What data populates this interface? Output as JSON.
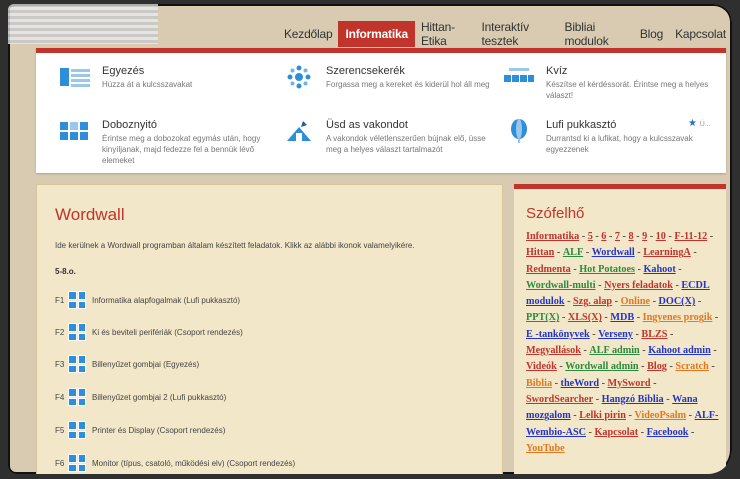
{
  "nav": {
    "items": [
      "Kezdőlap",
      "Informatika",
      "Hittan-Etika",
      "Interaktív tesztek",
      "Bibliai modulok",
      "Blog",
      "Kapcsolat"
    ],
    "active_index": 1
  },
  "dropdown": {
    "items": [
      {
        "title": "Egyezés",
        "desc": "Húzza át a kulcsszavakat",
        "icon": "match-icon"
      },
      {
        "title": "Szerencsekerék",
        "desc": "Forgassa meg a kereket és kiderül hol áll meg",
        "icon": "wheel-icon"
      },
      {
        "title": "Kvíz",
        "desc": "Készítse el kérdéssorát. Érintse meg a helyes választ!",
        "icon": "quiz-icon"
      },
      {
        "title": "Doboznyitó",
        "desc": "Érintse meg a dobozokat egymás után, hogy kinyíljanak, majd fedezze fel a bennük lévő elemeket",
        "icon": "boxes-icon"
      },
      {
        "title": "Üsd as vakondot",
        "desc": "A vakondok véletlenszerűen bújnak elő, üsse meg a helyes választ tartalmazót",
        "icon": "mole-icon"
      },
      {
        "title": "Lufi pukkasztó",
        "desc": "Durrantsd ki a lufikat, hogy a kulcsszavak egyezzenek",
        "icon": "balloon-icon"
      }
    ],
    "star_label": "Ú..."
  },
  "main": {
    "title": "Wordwall",
    "intro": "Ide kerülnek a Wordwall programban általam készített feladatok. Klikk az alábbi ikonok valamelyikére.",
    "grade": "5-8.o.",
    "rows": [
      {
        "code": "F1",
        "label": "Informatika alapfogalmak (Lufi pukkasztó)"
      },
      {
        "code": "F2",
        "label": "Ki és beviteli perifériák (Csoport rendezés)"
      },
      {
        "code": "F3",
        "label": "Billenyűzet gombjai (Egyezés)"
      },
      {
        "code": "F4",
        "label": "Billenyűzet gombjai 2 (Lufi pukkasztó)"
      },
      {
        "code": "F5",
        "label": "Printer és Display (Csoport rendezés)"
      },
      {
        "code": "F6",
        "label": "Monitor (típus, csatoló, működési elv) (Csoport rendezés)"
      }
    ]
  },
  "sidebar": {
    "title": "Szófelhő",
    "tags": [
      {
        "t": "Informatika",
        "c": "#c0342b"
      },
      {
        "t": "5",
        "c": "#c0342b"
      },
      {
        "t": "6",
        "c": "#c0342b"
      },
      {
        "t": "7",
        "c": "#c0342b"
      },
      {
        "t": "8",
        "c": "#c0342b"
      },
      {
        "t": "9",
        "c": "#c0342b"
      },
      {
        "t": "10",
        "c": "#c0342b"
      },
      {
        "t": "F-11-12",
        "c": "#c0342b"
      },
      {
        "t": "Hittan",
        "c": "#c0342b"
      },
      {
        "t": "ALF",
        "c": "#2b8a3e"
      },
      {
        "t": "Wordwall",
        "c": "#2334c9"
      },
      {
        "t": "LearningA",
        "c": "#c0342b"
      },
      {
        "t": "Redmenta",
        "c": "#c0342b"
      },
      {
        "t": "Hot Potatoes",
        "c": "#2b8a3e"
      },
      {
        "t": "Kahoot",
        "c": "#2334c9"
      },
      {
        "t": "Wordwall-multi",
        "c": "#2b8a3e"
      },
      {
        "t": "Nyers feladatok",
        "c": "#c0342b"
      },
      {
        "t": "ECDL modulok",
        "c": "#2334c9"
      },
      {
        "t": "Szg. alap",
        "c": "#c0342b"
      },
      {
        "t": "Online",
        "c": "#e0781e"
      },
      {
        "t": "DOC(X)",
        "c": "#2334c9"
      },
      {
        "t": "PPT(X)",
        "c": "#2b8a3e"
      },
      {
        "t": "XLS(X)",
        "c": "#c0342b"
      },
      {
        "t": "MDB",
        "c": "#2334c9"
      },
      {
        "t": "Ingyenes progik",
        "c": "#e0781e"
      },
      {
        "t": "E -tankönyvek",
        "c": "#2334c9"
      },
      {
        "t": "Verseny",
        "c": "#2334c9"
      },
      {
        "t": "BLZS",
        "c": "#c0342b"
      },
      {
        "t": "Megyallások",
        "c": "#c0342b"
      },
      {
        "t": "ALF admin",
        "c": "#2b8a3e"
      },
      {
        "t": "Kahoot admin",
        "c": "#2334c9"
      },
      {
        "t": "Videók",
        "c": "#c0342b"
      },
      {
        "t": "Wordwall admin",
        "c": "#2b8a3e"
      },
      {
        "t": "Blog",
        "c": "#c0342b"
      },
      {
        "t": "Scratch",
        "c": "#e0781e"
      },
      {
        "t": "Biblia",
        "c": "#e0781e"
      },
      {
        "t": "theWord",
        "c": "#2334c9"
      },
      {
        "t": "MySword",
        "c": "#c0342b"
      },
      {
        "t": "SwordSearcher",
        "c": "#c0342b"
      },
      {
        "t": "Hangzó Biblia",
        "c": "#2334c9"
      },
      {
        "t": "Wana mozgalom",
        "c": "#2334c9"
      },
      {
        "t": "Lelki pirin",
        "c": "#c0342b"
      },
      {
        "t": "VideoPsalm",
        "c": "#e0781e"
      },
      {
        "t": "ALF-Wembio-ASC",
        "c": "#2334c9"
      },
      {
        "t": "Kapcsolat",
        "c": "#c0342b"
      },
      {
        "t": "Facebook",
        "c": "#2334c9"
      },
      {
        "t": "YouTube",
        "c": "#e0781e"
      }
    ]
  }
}
